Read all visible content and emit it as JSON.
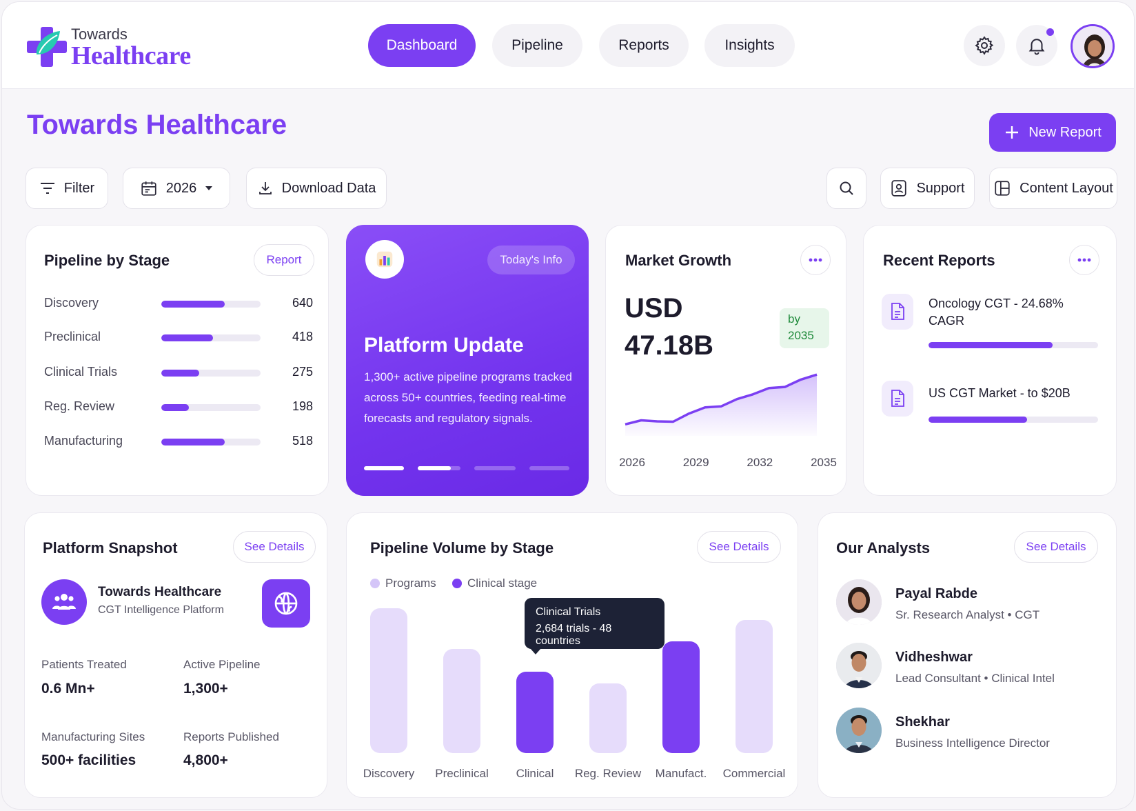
{
  "brand": {
    "small": "Towards",
    "big": "Healthcare",
    "accent": "#7b3ff2"
  },
  "nav": {
    "items": [
      "Dashboard",
      "Pipeline",
      "Reports",
      "Insights"
    ],
    "active": "Dashboard"
  },
  "header": {
    "settings_icon": "gear-icon",
    "notifications_icon": "bell-icon",
    "avatar": "user-avatar"
  },
  "page": {
    "title": "Towards Healthcare",
    "new_report": "New Report"
  },
  "toolbar": {
    "filter": "Filter",
    "year": "2026",
    "download": "Download Data",
    "support": "Support",
    "layout": "Content Layout"
  },
  "pipeline_by_stage": {
    "title": "Pipeline by Stage",
    "action": "Report",
    "rows": [
      {
        "label": "Discovery",
        "value": "640",
        "fill": 0.64
      },
      {
        "label": "Preclinical",
        "value": "418",
        "fill": 0.52
      },
      {
        "label": "Clinical Trials",
        "value": "275",
        "fill": 0.38
      },
      {
        "label": "Reg. Review",
        "value": "198",
        "fill": 0.28
      },
      {
        "label": "Manufacturing",
        "value": "518",
        "fill": 0.64
      }
    ]
  },
  "promo": {
    "pill": "Today's Info",
    "title": "Platform Update",
    "body": "1,300+ active pipeline programs tracked across 50+ countries, feeding real-time forecasts and regulatory signals.",
    "slide_index": 2,
    "slide_count": 4
  },
  "market_growth": {
    "title": "Market Growth",
    "currency": "USD",
    "value": "47.18B",
    "badge_line1": "by",
    "badge_line2": "2035",
    "x_labels": [
      "2026",
      "2029",
      "2032",
      "2035"
    ]
  },
  "recent_reports": {
    "title": "Recent Reports",
    "items": [
      {
        "text": "Oncology CGT - 24.68% CAGR",
        "progress": 0.73
      },
      {
        "text": "US CGT Market - to $20B",
        "progress": 0.58
      }
    ]
  },
  "platform_snapshot": {
    "title": "Platform Snapshot",
    "action": "See Details",
    "org_name": "Towards Healthcare",
    "org_sub": "CGT Intelligence Platform",
    "stats": [
      {
        "label": "Patients Treated",
        "value": "0.6 Mn+"
      },
      {
        "label": "Active Pipeline",
        "value": "1,300+"
      },
      {
        "label": "Manufacturing Sites",
        "value": "500+ facilities"
      },
      {
        "label": "Reports Published",
        "value": "4,800+"
      }
    ]
  },
  "pipeline_volume": {
    "title": "Pipeline Volume by Stage",
    "action": "See Details",
    "legend": [
      "Programs",
      "Clinical stage"
    ],
    "tooltip_title": "Clinical Trials",
    "tooltip_body": "2,684 trials - 48 countries",
    "colors": {
      "light": "#e6dcfb",
      "dark": "#7b3ff2",
      "legend_light": "#d4c5f8"
    }
  },
  "chart_data": [
    {
      "type": "line",
      "x": [
        "2026",
        "2029",
        "2032",
        "2035"
      ],
      "y": [
        20.5,
        26.3,
        36.6,
        47.18
      ],
      "xlabel": "",
      "ylabel": "",
      "grid": false
    },
    {
      "type": "bar",
      "categories": [
        "Discovery",
        "Preclinical",
        "Clinical",
        "Reg. Review",
        "Manufact.",
        "Commercial"
      ],
      "values": [
        100,
        72,
        56,
        48,
        77,
        92
      ],
      "highlight": [
        "Clinical",
        "Manufact."
      ],
      "ylim": [
        0,
        100
      ],
      "grid": false,
      "legend": "top-left"
    }
  ],
  "analysts": {
    "title": "Our Analysts",
    "action": "See Details",
    "items": [
      {
        "name": "Payal Rabde",
        "role": "Sr. Research Analyst  •  CGT"
      },
      {
        "name": "Vidheshwar",
        "role": "Lead Consultant  •  Clinical Intel"
      },
      {
        "name": "Shekhar",
        "role": "Business Intelligence Director"
      }
    ]
  }
}
